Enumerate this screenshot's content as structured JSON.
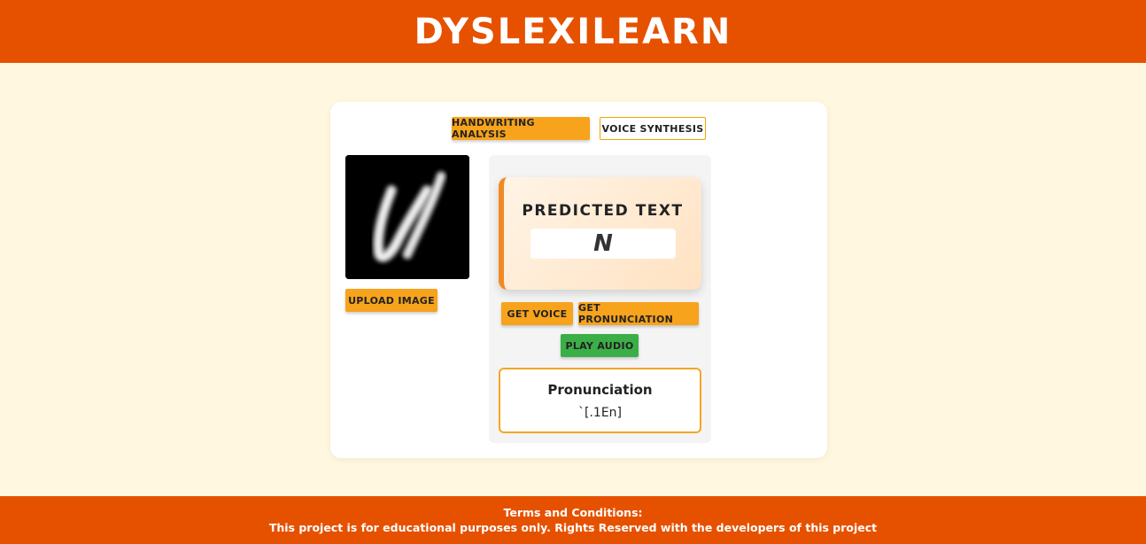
{
  "header": {
    "title": "DYSLEXILEARN"
  },
  "tabs": [
    {
      "label": "HANDWRITING ANALYSIS",
      "active": true
    },
    {
      "label": "VOICE SYNTHESIS",
      "active": false
    }
  ],
  "upload": {
    "button_label": "UPLOAD IMAGE"
  },
  "prediction": {
    "title": "PREDICTED TEXT",
    "value": "N"
  },
  "actions": {
    "get_voice_label": "GET VOICE",
    "get_pronunciation_label": "GET PRONUNCIATION",
    "play_audio_label": "PLAY AUDIO"
  },
  "pronunciation": {
    "title": "Pronunciation",
    "value": "`[.1En]"
  },
  "footer": {
    "line1": "Terms and Conditions:",
    "line2": "This project is for educational purposes only. Rights Reserved with the developers of this project"
  },
  "colors": {
    "header_bg": "#e65100",
    "page_bg": "#fff7df",
    "accent": "#f7a31c",
    "play_green": "#3cae48"
  }
}
